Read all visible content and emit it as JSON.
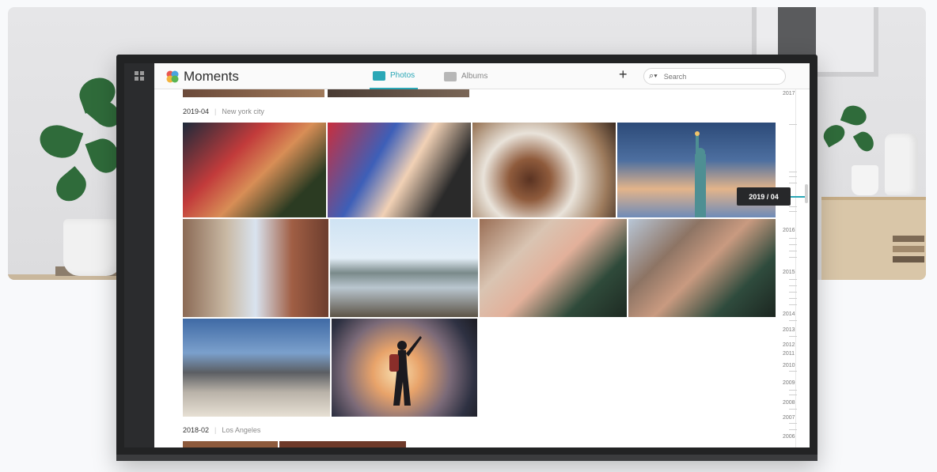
{
  "app": {
    "title": "Moments",
    "colors": {
      "accent": "#2aa7b6",
      "rail": "#2b2c2e",
      "badge": "#27282a"
    }
  },
  "rail": {
    "icon": "grid-icon"
  },
  "header": {
    "tabs": [
      {
        "label": "Photos",
        "icon": "image-icon",
        "active": true
      },
      {
        "label": "Albums",
        "icon": "album-icon",
        "active": false
      }
    ],
    "add_icon": "plus-icon",
    "search": {
      "icon": "search-icon",
      "placeholder": "Search"
    }
  },
  "sections": [
    {
      "date": "2019-04",
      "location": "New york city",
      "photos": [
        "selfie-couple-times-square",
        "selfie-woman-neon-signs",
        "steak-dinner-plate",
        "statue-of-liberty",
        "city-street-buildings",
        "waterfront-benches-skyline",
        "couple-selfie-bridge",
        "man-selfie-brooklyn-bridge",
        "skyline-bridge-railing",
        "hiker-silhouette-sunset"
      ]
    },
    {
      "date": "2018-02",
      "location": "Los Angeles",
      "photos": []
    }
  ],
  "timeline": {
    "current": "2019 / 04",
    "years": [
      "2017",
      "2016",
      "2015",
      "2014",
      "2013",
      "2012",
      "2011",
      "2010",
      "2009",
      "2008",
      "2007",
      "2006"
    ]
  }
}
